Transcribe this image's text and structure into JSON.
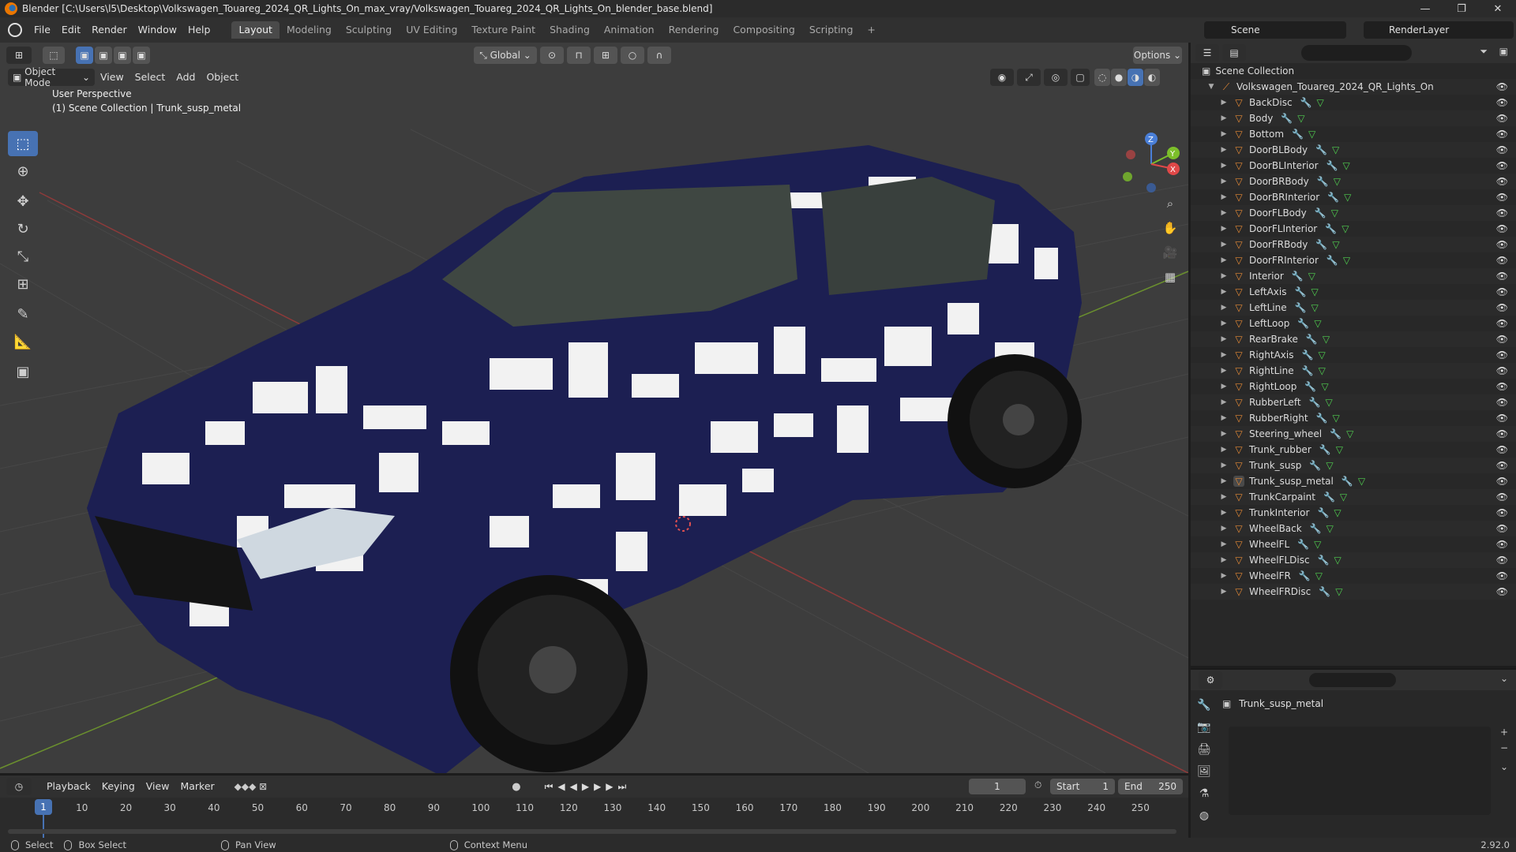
{
  "window": {
    "title": "Blender [C:\\Users\\l5\\Desktop\\Volkswagen_Touareg_2024_QR_Lights_On_max_vray/Volkswagen_Touareg_2024_QR_Lights_On_blender_base.blend]",
    "minimize": "—",
    "restore": "❐",
    "close": "✕"
  },
  "menu": [
    "File",
    "Edit",
    "Render",
    "Window",
    "Help"
  ],
  "workspaces": [
    "Layout",
    "Modeling",
    "Sculpting",
    "UV Editing",
    "Texture Paint",
    "Shading",
    "Animation",
    "Rendering",
    "Compositing",
    "Scripting"
  ],
  "active_workspace": "Layout",
  "add_workspace": "+",
  "scene": "Scene",
  "render_layer": "RenderLayer",
  "viewport": {
    "mode": "Object Mode",
    "menus": [
      "View",
      "Select",
      "Add",
      "Object"
    ],
    "transform_orientation": "Global",
    "options": "Options",
    "perspective": "User Perspective",
    "context": "(1) Scene Collection | Trunk_susp_metal"
  },
  "gizmo": {
    "x": "X",
    "y": "Y",
    "z": "Z"
  },
  "outliner": {
    "root": "Scene Collection",
    "collection": "Volkswagen_Touareg_2024_QR_Lights_On",
    "objects": [
      "BackDisc",
      "Body",
      "Bottom",
      "DoorBLBody",
      "DoorBLInterior",
      "DoorBRBody",
      "DoorBRInterior",
      "DoorFLBody",
      "DoorFLInterior",
      "DoorFRBody",
      "DoorFRInterior",
      "Interior",
      "LeftAxis",
      "LeftLine",
      "LeftLoop",
      "RearBrake",
      "RightAxis",
      "RightLine",
      "RightLoop",
      "RubberLeft",
      "RubberRight",
      "Steering_wheel",
      "Trunk_rubber",
      "Trunk_susp",
      "Trunk_susp_metal",
      "TrunkCarpaint",
      "TrunkInterior",
      "WheelBack",
      "WheelFL",
      "WheelFLDisc",
      "WheelFR",
      "WheelFRDisc"
    ],
    "selected": "Trunk_susp_metal"
  },
  "properties": {
    "object_name": "Trunk_susp_metal"
  },
  "timeline": {
    "menus": [
      "Playback",
      "Keying",
      "View",
      "Marker"
    ],
    "current_frame": "1",
    "start_label": "Start",
    "start": "1",
    "end_label": "End",
    "end": "250",
    "ticks": [
      "1",
      "10",
      "20",
      "30",
      "40",
      "50",
      "60",
      "70",
      "80",
      "90",
      "100",
      "110",
      "120",
      "130",
      "140",
      "150",
      "160",
      "170",
      "180",
      "190",
      "200",
      "210",
      "220",
      "230",
      "240",
      "250"
    ]
  },
  "statusbar": {
    "select": "Select",
    "box_select": "Box Select",
    "pan_view": "Pan View",
    "context_menu": "Context Menu",
    "version": "2.92.0"
  }
}
